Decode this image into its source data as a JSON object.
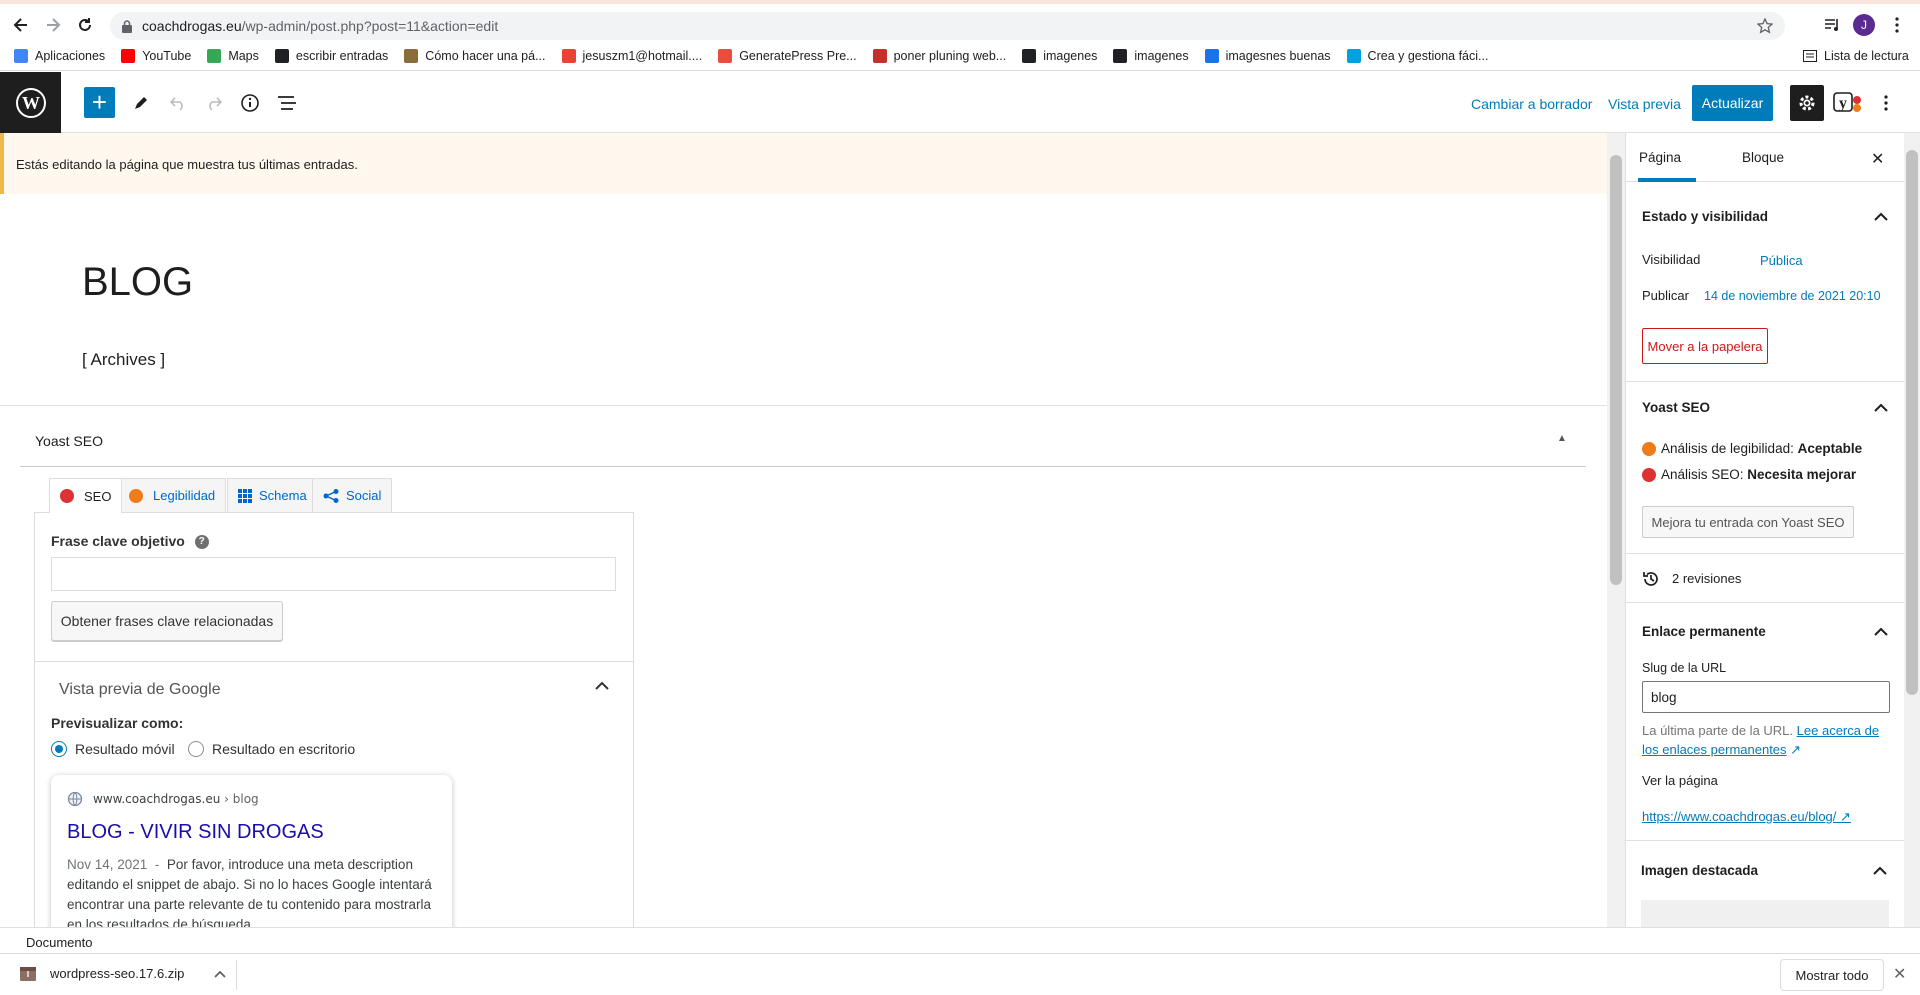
{
  "browser": {
    "url_host": "coachdrogas.eu",
    "url_path": "/wp-admin/post.php?post=11&action=edit",
    "bookmarks": [
      {
        "label": "Aplicaciones",
        "color": "#4285f4"
      },
      {
        "label": "YouTube",
        "color": "#ff0000"
      },
      {
        "label": "Maps",
        "color": "#34a853"
      },
      {
        "label": "escribir entradas",
        "color": "#202124"
      },
      {
        "label": "Cómo hacer una pá...",
        "color": "#8a6d3b"
      },
      {
        "label": "jesuszm1@hotmail....",
        "color": "#ea4335"
      },
      {
        "label": "GeneratePress Pre...",
        "color": "#e94e3c"
      },
      {
        "label": "poner pluning web...",
        "color": "#c4302b"
      },
      {
        "label": "imagenes",
        "color": "#202124"
      },
      {
        "label": "imagenes",
        "color": "#202124"
      },
      {
        "label": "imagesnes buenas",
        "color": "#1a73e8"
      },
      {
        "label": "Crea y gestiona fáci...",
        "color": "#00a1e0"
      }
    ],
    "reading_list": "Lista de lectura",
    "avatar_letter": "J",
    "download_file": "wordpress-seo.17.6.zip",
    "show_all": "Mostrar todo"
  },
  "toolbar": {
    "switch_to_draft": "Cambiar a borrador",
    "preview": "Vista previa",
    "update": "Actualizar"
  },
  "editor": {
    "notice": "Estás editando la página que muestra tus últimas entradas.",
    "title": "BLOG",
    "shortcode": "[ Archives ]",
    "footer_breadcrumb": "Documento"
  },
  "yoast": {
    "heading": "Yoast SEO",
    "tabs": [
      "SEO",
      "Legibilidad",
      "Schema",
      "Social"
    ],
    "keyphrase_label": "Frase clave objetivo",
    "keyphrase_value": "",
    "related_btn": "Obtener frases clave relacionadas",
    "google_preview_heading": "Vista previa de Google",
    "preview_as": "Previsualizar como:",
    "radio_mobile": "Resultado móvil",
    "radio_desktop": "Resultado en escritorio",
    "serp_url_host": "www.coachdrogas.eu",
    "serp_url_path": "› blog",
    "serp_title": "BLOG - VIVIR SIN DROGAS",
    "serp_date": "Nov 14, 2021",
    "serp_desc": "Por favor, introduce una meta description editando el snippet de abajo. Si no lo haces Google intentará encontrar una parte relevante de tu contenido para mostrarla en los resultados de búsqueda."
  },
  "sidebar": {
    "tab_page": "Página",
    "tab_block": "Bloque",
    "status_title": "Estado y visibilidad",
    "visibility_label": "Visibilidad",
    "visibility_value": "Pública",
    "publish_label": "Publicar",
    "publish_value": "14 de noviembre de 2021 20:10",
    "trash_btn": "Mover a la papelera",
    "yoast_title": "Yoast SEO",
    "readability_label": "Análisis de legibilidad:",
    "readability_value": "Aceptable",
    "seo_label": "Análisis SEO:",
    "seo_value": "Necesita mejorar",
    "improve_btn": "Mejora tu entrada con Yoast SEO",
    "revisions": "2 revisiones",
    "permalink_title": "Enlace permanente",
    "slug_label": "Slug de la URL",
    "slug_value": "blog",
    "slug_help_prefix": "La última parte de la URL.",
    "slug_help_link": "Lee acerca de los enlaces permanentes",
    "view_page": "Ver la página",
    "page_url": "https://www.coachdrogas.eu/blog/",
    "featured_title": "Imagen destacada"
  },
  "colors": {
    "wp_blue": "#007cba",
    "seo_bad": "#dc3232",
    "readability_ok": "#ee7c1b"
  }
}
